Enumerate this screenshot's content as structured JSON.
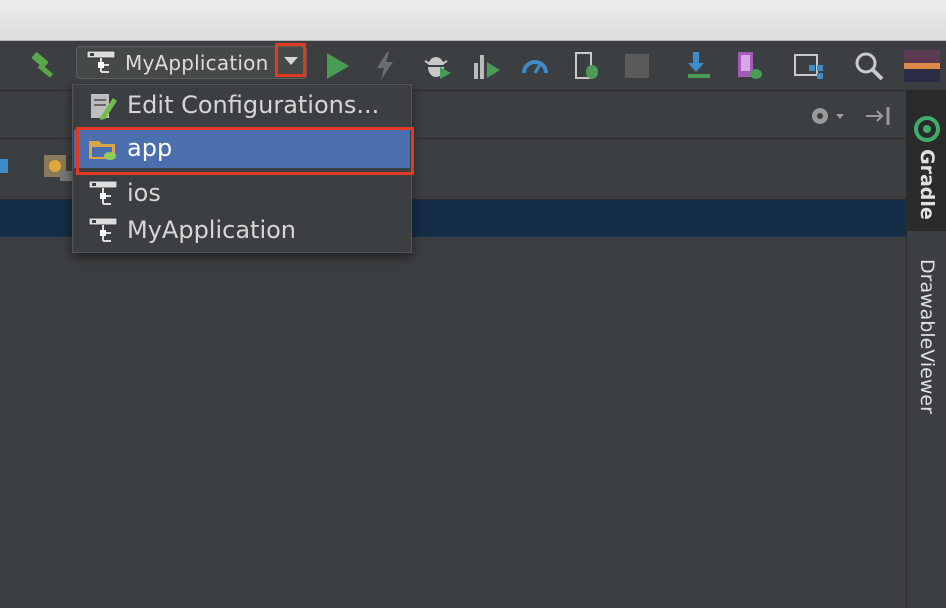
{
  "toolbar": {
    "run_config": "MyApplication"
  },
  "popup": {
    "items": [
      {
        "label": "Edit Configurations...",
        "icon": "edit-configurations-icon"
      },
      {
        "label": "app",
        "icon": "android-module-folder-icon",
        "selected": true
      },
      {
        "label": "ios",
        "icon": "module-hierarchy-icon"
      },
      {
        "label": "MyApplication",
        "icon": "module-hierarchy-icon"
      }
    ]
  },
  "side_tabs": {
    "gradle": "Gradle",
    "drawable_viewer": "DrawableViewer"
  },
  "colors": {
    "selection": "#4b6eaf",
    "highlight_callout": "#e23a22",
    "row_highlight": "#152d46",
    "run_green": "#499c54"
  }
}
